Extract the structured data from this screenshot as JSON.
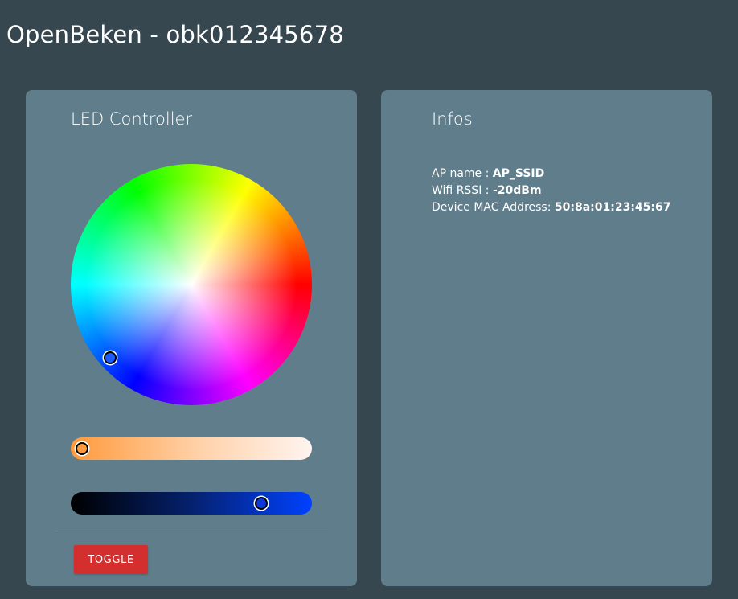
{
  "app": {
    "title": "OpenBeken - obk012345678"
  },
  "led_controller": {
    "title": "LED Controller",
    "toggle_label": "TOGGLE",
    "colors": {
      "toggle_bg": "#d32f2f",
      "selected_color": "#1a5cff",
      "temperature_color": "#ff9a3c",
      "brightness_color": "#0041ff"
    },
    "temperature_level": 0.05,
    "brightness_level": 0.79
  },
  "infos": {
    "title": "Infos",
    "rows": [
      {
        "label": "AP name : ",
        "value": "AP_SSID"
      },
      {
        "label": "Wifi RSSI : ",
        "value": "-20dBm"
      },
      {
        "label": "Device MAC Address: ",
        "value": "50:8a:01:23:45:67"
      }
    ]
  },
  "theme": {
    "background": "#37474f",
    "card": "#607d8b"
  }
}
